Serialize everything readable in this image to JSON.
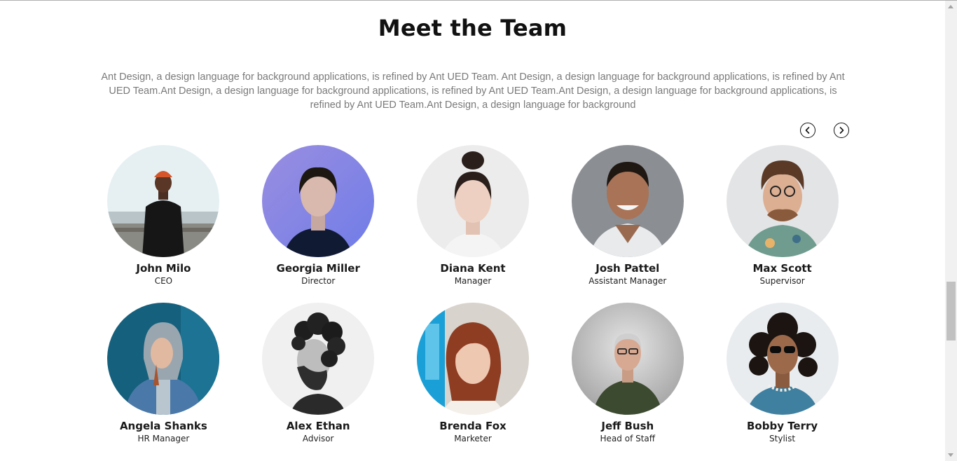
{
  "section": {
    "title": "Meet the Team",
    "description": "Ant Design, a design language for background applications, is refined by Ant UED Team. Ant Design, a design language for background applications, is refined by Ant UED Team.Ant Design, a design language for background applications, is refined by Ant UED Team.Ant Design, a design language for background applications, is refined by Ant UED Team.Ant Design, a design language for background"
  },
  "carousel": {
    "prev_icon": "chevron-left-icon",
    "next_icon": "chevron-right-icon"
  },
  "team": [
    {
      "name": "John Milo",
      "role": "CEO",
      "photo": "man-orange-beanie-photo"
    },
    {
      "name": "Georgia Miller",
      "role": "Director",
      "photo": "woman-purple-background-photo"
    },
    {
      "name": "Diana Kent",
      "role": "Manager",
      "photo": "smiling-woman-hair-bun-photo"
    },
    {
      "name": "Josh Pattel",
      "role": "Assistant Manager",
      "photo": "smiling-man-white-shirt-photo"
    },
    {
      "name": "Max Scott",
      "role": "Supervisor",
      "photo": "man-curly-hair-glasses-photo"
    },
    {
      "name": "Angela Shanks",
      "role": "HR Manager",
      "photo": "woman-denim-jacket-hood-photo"
    },
    {
      "name": "Alex Ethan",
      "role": "Advisor",
      "photo": "bearded-man-profile-bw-photo"
    },
    {
      "name": "Brenda Fox",
      "role": "Marketer",
      "photo": "red-haired-woman-photo"
    },
    {
      "name": "Jeff Bush",
      "role": "Head of Staff",
      "photo": "man-glasses-green-shirt-photo"
    },
    {
      "name": "Bobby Terry",
      "role": "Stylist",
      "photo": "man-curly-hair-sunglasses-photo"
    }
  ],
  "colors": {
    "title": "#111111",
    "description": "#7a7a7a",
    "nav_button_border": "#111111"
  }
}
